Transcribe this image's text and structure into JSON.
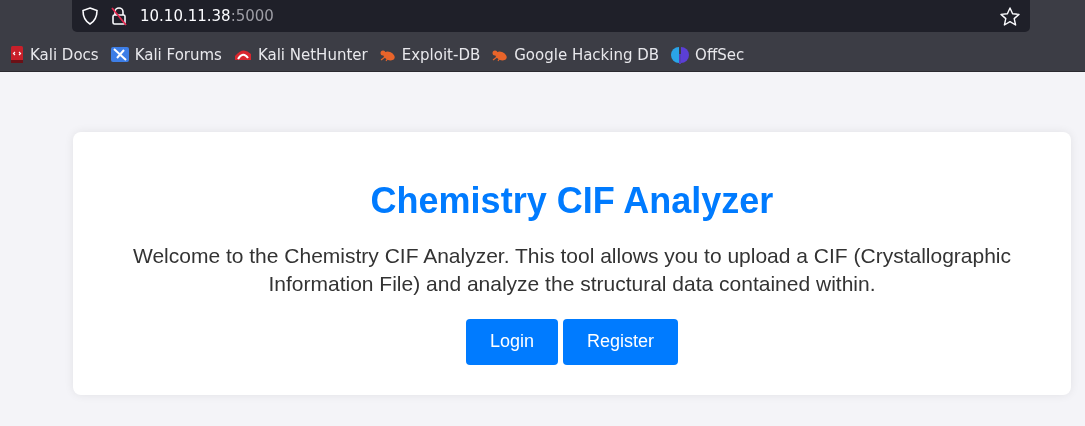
{
  "browser": {
    "address": {
      "host": "10.10.11.38",
      "port": ":5000"
    },
    "bookmarks": [
      {
        "label": "Kali Docs",
        "kind": "docs"
      },
      {
        "label": "Kali Forums",
        "kind": "forums"
      },
      {
        "label": "Kali NetHunter",
        "kind": "nethunter"
      },
      {
        "label": "Exploit-DB",
        "kind": "bug"
      },
      {
        "label": "Google Hacking DB",
        "kind": "bug"
      },
      {
        "label": "OffSec",
        "kind": "offsec"
      }
    ]
  },
  "page": {
    "title": "Chemistry CIF Analyzer",
    "intro": "Welcome to the Chemistry CIF Analyzer. This tool allows you to upload a CIF (Crystallographic Information File) and analyze the structural data contained within.",
    "buttons": [
      "Login",
      "Register"
    ]
  }
}
